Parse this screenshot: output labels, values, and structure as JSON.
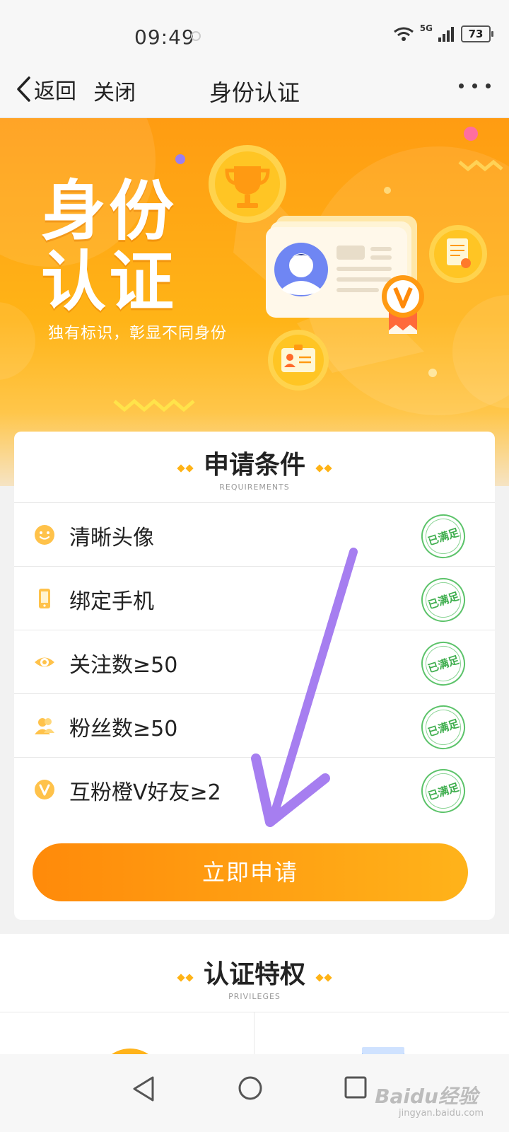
{
  "status_bar": {
    "time": "09:49",
    "network": "5G",
    "battery": "73"
  },
  "nav": {
    "back_label": "返回",
    "close_label": "关闭",
    "title": "身份认证"
  },
  "banner": {
    "hero_line1": "身份",
    "hero_line2": "认证",
    "subtitle": "独有标识，彰显不同身份"
  },
  "requirements": {
    "title": "申请条件",
    "title_en": "REQUIREMENTS",
    "items": [
      {
        "label": "清晰头像",
        "status": "已满足",
        "icon": "smile-face-icon"
      },
      {
        "label": "绑定手机",
        "status": "已满足",
        "icon": "phone-icon"
      },
      {
        "label": "关注数≥50",
        "status": "已满足",
        "icon": "eye-icon"
      },
      {
        "label": "粉丝数≥50",
        "status": "已满足",
        "icon": "fans-icon"
      },
      {
        "label": "互粉橙V好友≥2",
        "status": "已满足",
        "icon": "v-badge-icon"
      }
    ]
  },
  "apply_button": "立即申请",
  "privileges": {
    "title": "认证特权",
    "title_en": "PRIVILEGES"
  },
  "watermark": {
    "brand": "Baidu经验",
    "url": "jingyan.baidu.com"
  },
  "colors": {
    "accent": "#ff9c12",
    "button_start": "#ff8a0a",
    "button_end": "#ffb31a",
    "stamp_green": "#3fae4e",
    "annotation_arrow": "#a67ef0"
  }
}
